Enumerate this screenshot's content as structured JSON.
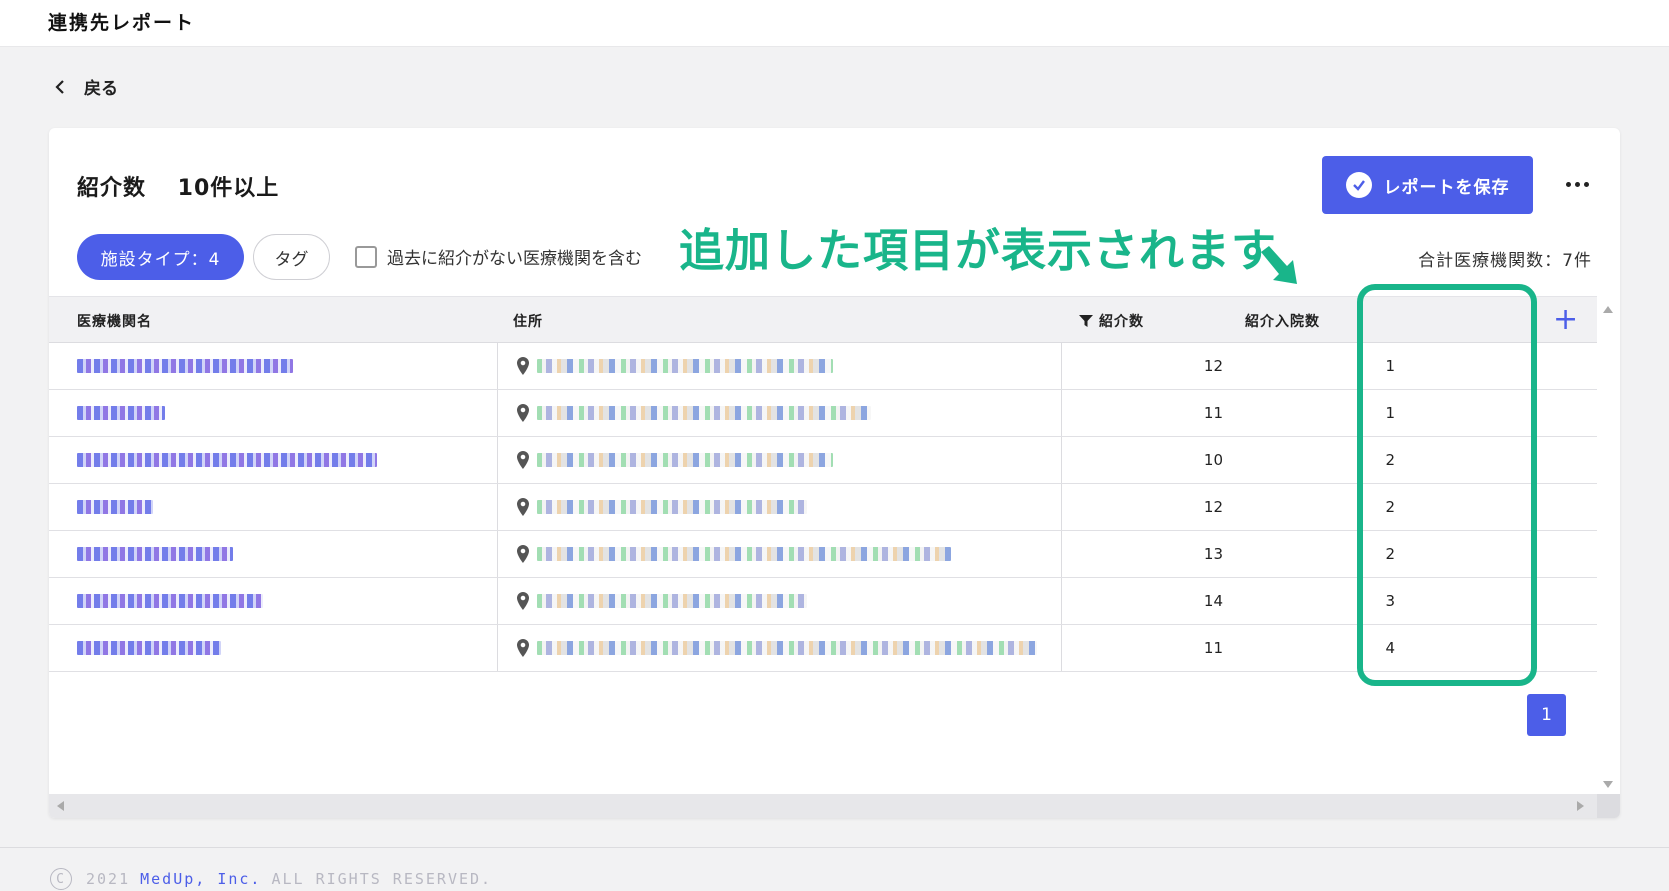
{
  "header": {
    "title": "連携先レポート"
  },
  "nav": {
    "back_label": "戻る"
  },
  "report": {
    "title": "紹介数　 10件以上",
    "save_label": "レポートを保存",
    "total_label": "合計医療機関数：7件"
  },
  "filters": {
    "facility_chip": "施設タイプ：4",
    "tag_chip": "タグ",
    "past_checkbox_label": "過去に紹介がない医療機関を含む"
  },
  "annotation": {
    "text": "追加した項目が表示されます",
    "color": "#19b58a"
  },
  "table": {
    "columns": [
      "医療機関名",
      "住所",
      "紹介数",
      "紹介入院数"
    ],
    "rows": [
      {
        "referrals": "12",
        "admissions": "1"
      },
      {
        "referrals": "11",
        "admissions": "1"
      },
      {
        "referrals": "10",
        "admissions": "2"
      },
      {
        "referrals": "12",
        "admissions": "2"
      },
      {
        "referrals": "13",
        "admissions": "2"
      },
      {
        "referrals": "14",
        "admissions": "3"
      },
      {
        "referrals": "11",
        "admissions": "4"
      }
    ]
  },
  "pagination": {
    "current_page": "1"
  },
  "footer": {
    "copyright_symbol": "C",
    "year": "2021",
    "brand": "MedUp, Inc.",
    "rights": "ALL RIGHTS RESERVED."
  },
  "colors": {
    "accent": "#4c5ee8",
    "annotation": "#19b58a"
  }
}
